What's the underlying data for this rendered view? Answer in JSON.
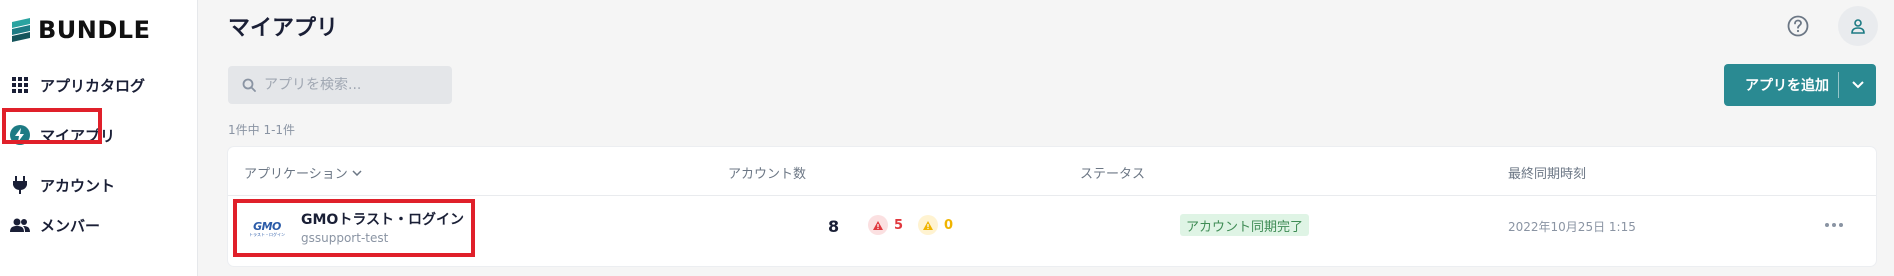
{
  "brand": {
    "name": "BUNDLE"
  },
  "sidebar": {
    "items": [
      {
        "label": "アプリカタログ",
        "icon": "grid-icon",
        "active": false
      },
      {
        "label": "マイアプリ",
        "icon": "bolt-icon",
        "active": true
      },
      {
        "label": "アカウント",
        "icon": "plug-icon",
        "active": false
      },
      {
        "label": "メンバー",
        "icon": "people-icon",
        "active": false
      }
    ]
  },
  "header": {
    "title": "マイアプリ",
    "help_icon": "help-circle-icon",
    "user_icon": "user-icon"
  },
  "search": {
    "placeholder": "アプリを検索..."
  },
  "toolbar": {
    "add_label": "アプリを追加"
  },
  "list": {
    "count_text": "1件中 1-1件",
    "columns": [
      "アプリケーション",
      "アカウント数",
      "ステータス",
      "最終同期時刻"
    ],
    "rows": [
      {
        "logo_text": "GMO",
        "logo_sub": "トラスト・ログイン",
        "name": "GMOトラスト・ログイン",
        "subtitle": "gssupport-test",
        "account_count": "8",
        "error_count": "5",
        "warning_count": "0",
        "status": "アカウント同期完了",
        "last_sync": "2022年10月25日 1:15"
      }
    ]
  },
  "colors": {
    "accent": "#2a8a92",
    "highlight": "#e0202a",
    "status_bg": "#dff4e5",
    "status_text": "#3f8c55",
    "error": "#e0383e",
    "warning": "#f0b400"
  }
}
